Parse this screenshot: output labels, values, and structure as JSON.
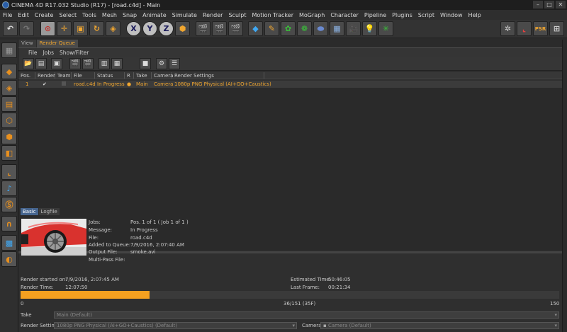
{
  "window": {
    "title": "CINEMA 4D R17.032 Studio (R17) - [road.c4d] - Main",
    "controls": [
      "–",
      "□",
      "✕"
    ]
  },
  "menu": [
    "File",
    "Edit",
    "Create",
    "Select",
    "Tools",
    "Mesh",
    "Snap",
    "Animate",
    "Simulate",
    "Render",
    "Sculpt",
    "Motion Tracker",
    "MoGraph",
    "Character",
    "Pipeline",
    "Plugins",
    "Script",
    "Window",
    "Help"
  ],
  "toolbar": {
    "axis_x": "X",
    "axis_y": "Y",
    "axis_z": "Z",
    "layout_label": "PSR"
  },
  "tabs": [
    "View",
    "Render Queue"
  ],
  "panel_menu": [
    "File",
    "Jobs",
    "Show/Filter"
  ],
  "table": {
    "headers": [
      "Pos.",
      "Render",
      "Team",
      "File",
      "Status",
      "R",
      "Take",
      "Camera",
      "Render Settings"
    ],
    "rows": [
      {
        "pos": "1",
        "render": "✔",
        "team": "",
        "file": "road.c4d",
        "status": "In Progress",
        "r": "●",
        "take": "Main",
        "camera": "Camera",
        "settings": "1080p PNG Physical (AI+GO+Caustics)"
      }
    ]
  },
  "bottom_tabs": [
    "Basic",
    "Logfile"
  ],
  "info": {
    "labels": [
      "Jobs:",
      "Message:",
      "File:",
      "Added to Queue:",
      "Output File:",
      "Multi-Pass File:"
    ],
    "values": [
      "Pos. 1 of 1 ( Job 1 of 1 )",
      "In Progress",
      "road.c4d",
      "7/9/2016, 2:07:40 AM",
      "smoke.avi",
      ""
    ]
  },
  "stats": {
    "render_started_label": "Render started on:",
    "render_started_value": "7/9/2016, 2:07:45 AM",
    "render_time_label": "Render Time:",
    "render_time_value": "12:07:50",
    "estimated_label": "Estimated Time:",
    "estimated_value": "50:46:05",
    "last_frame_label": "Last Frame:",
    "last_frame_value": "00:21:34"
  },
  "progress": {
    "min_label": "0",
    "max_label": "150",
    "center_label": "36/151 (35F)",
    "fraction": 0.24,
    "color": "#f5a020"
  },
  "footer": {
    "take_label": "Take",
    "take_value": "Main (Default)",
    "settings_label": "Render Settings",
    "settings_value": "1080p PNG Physical (AI+GO+Caustics) (Default)",
    "camera_label": "Camera",
    "camera_value": "Camera (Default)"
  },
  "colors": {
    "accent": "#f0a630",
    "selected_tab": "#46658f"
  }
}
